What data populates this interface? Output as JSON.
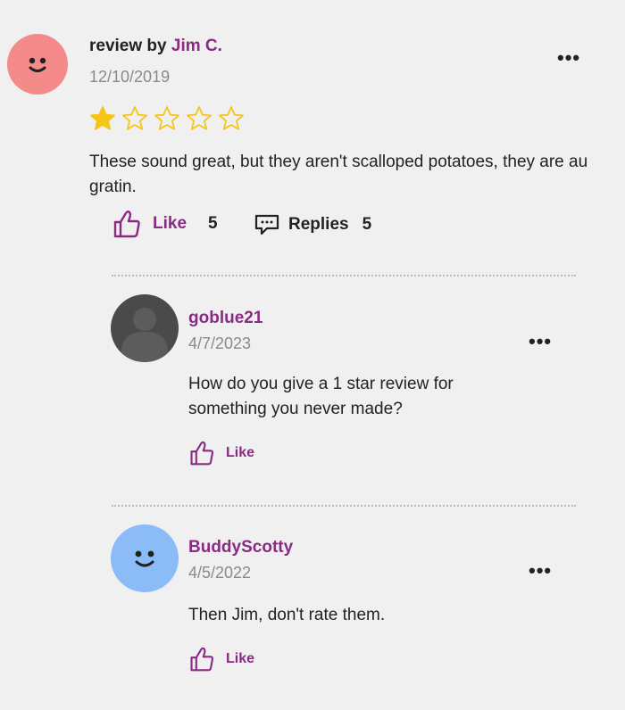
{
  "review": {
    "prefix": "review by",
    "author": "Jim C.",
    "date": "12/10/2019",
    "rating": 1,
    "rating_max": 5,
    "text": "These sound great, but they aren't scalloped potatoes, they are au gratin.",
    "like_label": "Like",
    "like_count": "5",
    "replies_label": "Replies",
    "replies_count": "5",
    "more_label": "•••"
  },
  "replies": [
    {
      "author": "goblue21",
      "date": "4/7/2023",
      "text": "How do you give a 1 star review for something you never made?",
      "like_label": "Like",
      "more_label": "•••"
    },
    {
      "author": "BuddyScotty",
      "date": "4/5/2022",
      "text": "Then Jim, don't rate them.",
      "like_label": "Like",
      "more_label": "•••"
    }
  ],
  "colors": {
    "accent": "#8a2a82",
    "avatar_red": "#f48a8a",
    "avatar_blue": "#8bbcf7",
    "avatar_gray": "#4a4a4a",
    "star": "#f5c518"
  },
  "icons": [
    "smiley-icon",
    "star-icon",
    "thumbs-up-icon",
    "comment-icon",
    "more-icon",
    "default-user-icon"
  ]
}
